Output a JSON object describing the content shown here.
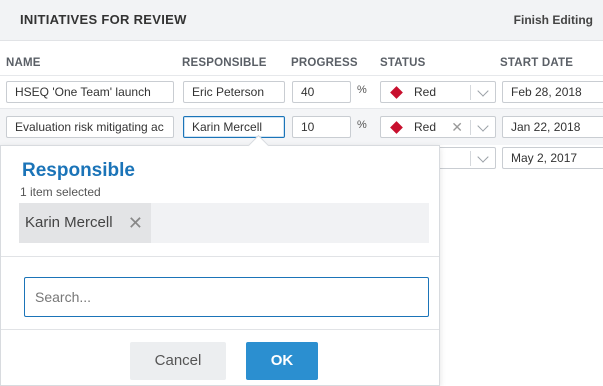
{
  "header": {
    "title": "INITIATIVES FOR REVIEW",
    "finish_label": "Finish Editing"
  },
  "columns": [
    "NAME",
    "RESPONSIBLE",
    "PROGRESS",
    "STATUS",
    "START DATE"
  ],
  "rows": [
    {
      "name": "HSEQ 'One Team' launch",
      "responsible": "Eric Peterson",
      "progress": "40",
      "percent": "%",
      "status": "Red",
      "start_date": "Feb 28, 2018"
    },
    {
      "name": "Evaluation risk mitigating ac",
      "responsible": "Karin Mercell",
      "progress": "10",
      "percent": "%",
      "status": "Red",
      "start_date": "Jan 22, 2018"
    },
    {
      "start_date": "May 2, 2017"
    }
  ],
  "status_color": "#c8102e",
  "popup": {
    "title": "Responsible",
    "count_text": "1 item selected",
    "selected_chip": "Karin Mercell",
    "search_placeholder": "Search...",
    "cancel_label": "Cancel",
    "ok_label": "OK"
  },
  "accent_color": "#1b74b8"
}
